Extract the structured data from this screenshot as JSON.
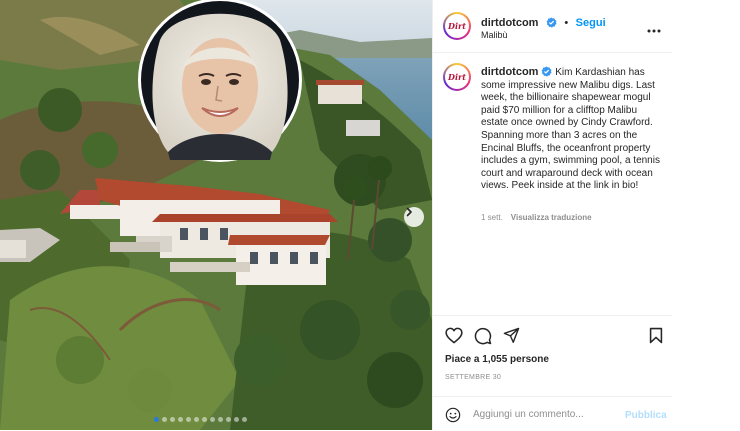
{
  "post": {
    "username": "dirtdotcom",
    "avatar_text": "Dirt",
    "follow_label": "Segui",
    "separator": "•",
    "location": "Malibù",
    "caption_text": "Kim Kardashian has some impressive new Malibu digs. Last week, the billionaire shapewear mogul paid $70 million for a clifftop Malibu estate once owned by Cindy Crawford. Spanning more than 3 acres on the Encinal Bluffs, the oceanfront property includes a gym, swimming pool, a tennis court and wraparound deck with ocean views. Peek inside at the link in bio!",
    "age": "1 sett.",
    "translate_label": "Visualizza traduzione",
    "likes": "Piace a 1,055 persone",
    "date": "SETTEMBRE 30",
    "comment_placeholder": "Aggiungi un commento...",
    "publish_label": "Pubblica"
  },
  "carousel": {
    "slide_count": 12,
    "active_index": 0
  },
  "colors": {
    "verified": "#3897f0",
    "link": "#0095f6",
    "muted": "#8e8e8e",
    "avatar_ring": "#ee2a7b"
  },
  "icons": [
    "verified-badge-icon",
    "more-options-icon",
    "heart-icon",
    "comment-icon",
    "share-icon",
    "save-icon",
    "emoji-icon",
    "chevron-right-icon"
  ]
}
